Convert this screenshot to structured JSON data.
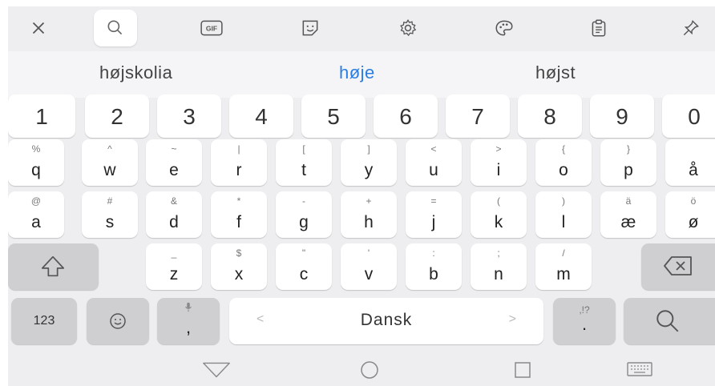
{
  "toolbar": {
    "icons": [
      "close-icon",
      "search-icon",
      "gif-icon",
      "sticker-icon",
      "settings-icon",
      "theme-palette-icon",
      "clipboard-icon",
      "pin-icon"
    ],
    "gif_label": "GIF"
  },
  "suggestions": {
    "left": "højskolia",
    "center": "høje",
    "right": "højst",
    "highlight_color": "#2b7de1"
  },
  "number_row": [
    "1",
    "2",
    "3",
    "4",
    "5",
    "6",
    "7",
    "8",
    "9",
    "0"
  ],
  "row1": [
    {
      "key": "q",
      "hint": "%"
    },
    {
      "key": "w",
      "hint": "^"
    },
    {
      "key": "e",
      "hint": "~"
    },
    {
      "key": "r",
      "hint": "|"
    },
    {
      "key": "t",
      "hint": "["
    },
    {
      "key": "y",
      "hint": "]"
    },
    {
      "key": "u",
      "hint": "<"
    },
    {
      "key": "i",
      "hint": ">"
    },
    {
      "key": "o",
      "hint": "{"
    },
    {
      "key": "p",
      "hint": "}"
    },
    {
      "key": "å",
      "hint": ""
    }
  ],
  "row2": [
    {
      "key": "a",
      "hint": "@"
    },
    {
      "key": "s",
      "hint": "#"
    },
    {
      "key": "d",
      "hint": "&"
    },
    {
      "key": "f",
      "hint": "*"
    },
    {
      "key": "g",
      "hint": "-"
    },
    {
      "key": "h",
      "hint": "+"
    },
    {
      "key": "j",
      "hint": "="
    },
    {
      "key": "k",
      "hint": "("
    },
    {
      "key": "l",
      "hint": ")"
    },
    {
      "key": "æ",
      "hint": "ä"
    },
    {
      "key": "ø",
      "hint": "ö"
    }
  ],
  "row3": [
    {
      "key": "z",
      "hint": "_"
    },
    {
      "key": "x",
      "hint": "$"
    },
    {
      "key": "c",
      "hint": "\""
    },
    {
      "key": "v",
      "hint": "'"
    },
    {
      "key": "b",
      "hint": ":"
    },
    {
      "key": "n",
      "hint": ";"
    },
    {
      "key": "m",
      "hint": "/"
    }
  ],
  "bottom_row": {
    "numbers_label": "123",
    "comma": ",",
    "space_label": "Dansk",
    "space_left_arrow": "<",
    "space_right_arrow": ">",
    "period": ".",
    "period_hint": ",!?"
  },
  "nav": {
    "icons": [
      "back-triangle-icon",
      "home-circle-icon",
      "recents-square-icon",
      "keyboard-switch-icon"
    ]
  }
}
